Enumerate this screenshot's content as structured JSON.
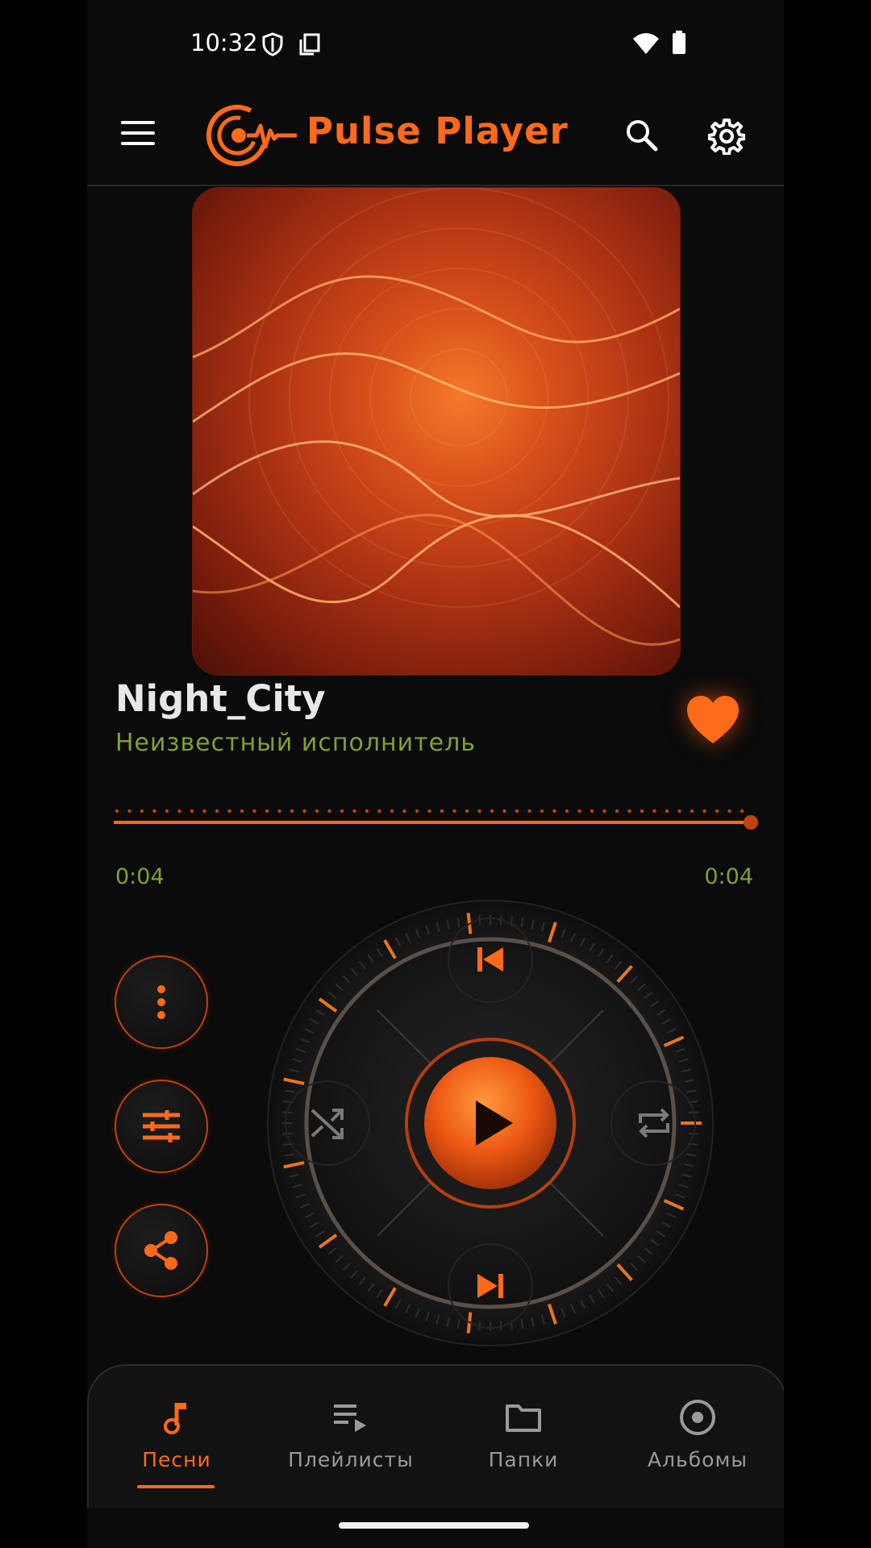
{
  "status_bar": {
    "time": "10:32",
    "icons": [
      "shield-icon",
      "screenshot-icon",
      "wifi-icon",
      "battery-icon"
    ]
  },
  "toolbar": {
    "title": "Pulse Player",
    "icons": [
      "menu-icon",
      "search-icon",
      "settings-icon"
    ]
  },
  "track": {
    "title": "Night_City",
    "artist": "Неизвестный исполнитель",
    "favorite": true
  },
  "progress": {
    "current": "0:04",
    "total": "0:04",
    "fraction": 1.0
  },
  "side_actions": [
    "more-vert-icon",
    "equalizer-icon",
    "share-icon"
  ],
  "wheel": {
    "controls": [
      "previous",
      "shuffle",
      "play",
      "repeat",
      "next"
    ]
  },
  "nav": {
    "items": [
      {
        "label": "Песни",
        "icon": "music-note-icon",
        "active": true
      },
      {
        "label": "Плейлисты",
        "icon": "playlist-icon",
        "active": false
      },
      {
        "label": "Папки",
        "icon": "folder-icon",
        "active": false
      },
      {
        "label": "Альбомы",
        "icon": "album-icon",
        "active": false
      }
    ]
  },
  "colors": {
    "accent": "#ff6a1a",
    "artist": "#7ea234",
    "background": "#0b0b0b"
  }
}
